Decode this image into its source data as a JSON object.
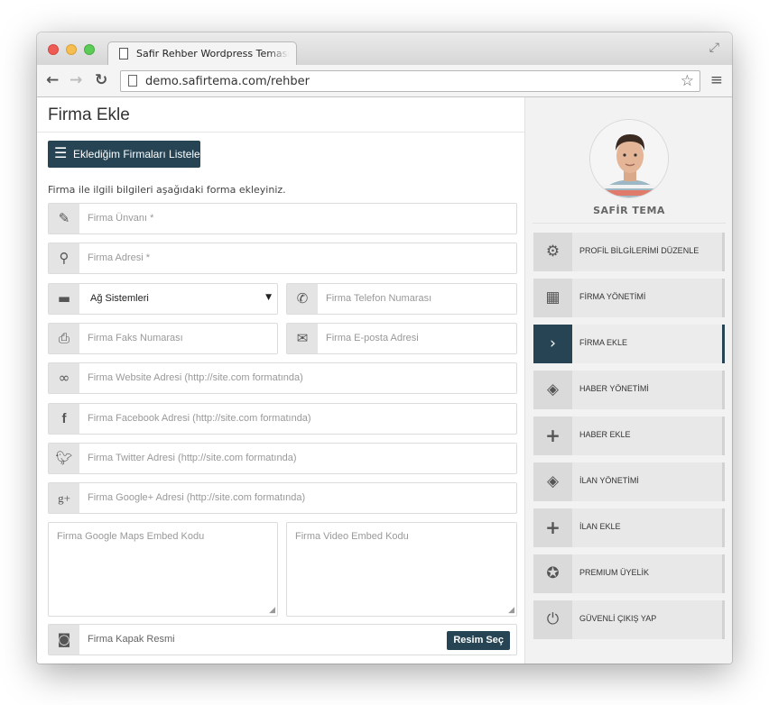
{
  "browser": {
    "tab_title": "Safir Rehber Wordpress Teması",
    "url": "demo.safirtema.com/rehber"
  },
  "page": {
    "title": "Firma Ekle",
    "list_button": "Eklediğim Firmaları Listele",
    "intro": "Firma ile ilgili bilgileri aşağıdaki forma ekleyiniz."
  },
  "form": {
    "company_name": "Firma Ünvanı *",
    "company_address": "Firma Adresi *",
    "category_selected": "Ağ Sistemleri",
    "phone": "Firma Telefon Numarası",
    "fax": "Firma Faks Numarası",
    "email": "Firma E-posta Adresi",
    "website": "Firma Website Adresi (http://site.com formatında)",
    "facebook": "Firma Facebook Adresi (http://site.com formatında)",
    "twitter": "Firma Twitter Adresi (http://site.com formatında)",
    "googleplus": "Firma Google+ Adresi (http://site.com formatında)",
    "maps_embed": "Firma Google Maps Embed Kodu",
    "video_embed": "Firma Video Embed Kodu",
    "cover_image": "Firma Kapak Resmi",
    "choose_image_button": "Resim Seç"
  },
  "sidebar": {
    "profile_name": "SAFİR TEMA",
    "items": [
      {
        "label": "PROFİL BİLGİLERİMİ DÜZENLE",
        "icon": "gear-icon"
      },
      {
        "label": "FİRMA YÖNETİMİ",
        "icon": "building-icon"
      },
      {
        "label": "FİRMA EKLE",
        "icon": "chevron-right-icon",
        "active": true
      },
      {
        "label": "HABER YÖNETİMİ",
        "icon": "layers-icon"
      },
      {
        "label": "HABER EKLE",
        "icon": "plus-icon"
      },
      {
        "label": "İLAN YÖNETİMİ",
        "icon": "layers-icon"
      },
      {
        "label": "İLAN EKLE",
        "icon": "plus-icon"
      },
      {
        "label": "PREMIUM ÜYELİK",
        "icon": "award-icon"
      },
      {
        "label": "GÜVENLİ ÇIKIŞ YAP",
        "icon": "power-icon"
      }
    ]
  },
  "colors": {
    "accent": "#264454",
    "addon_bg": "#e4e4e4",
    "sidebar_bg": "#f2f2f2"
  }
}
